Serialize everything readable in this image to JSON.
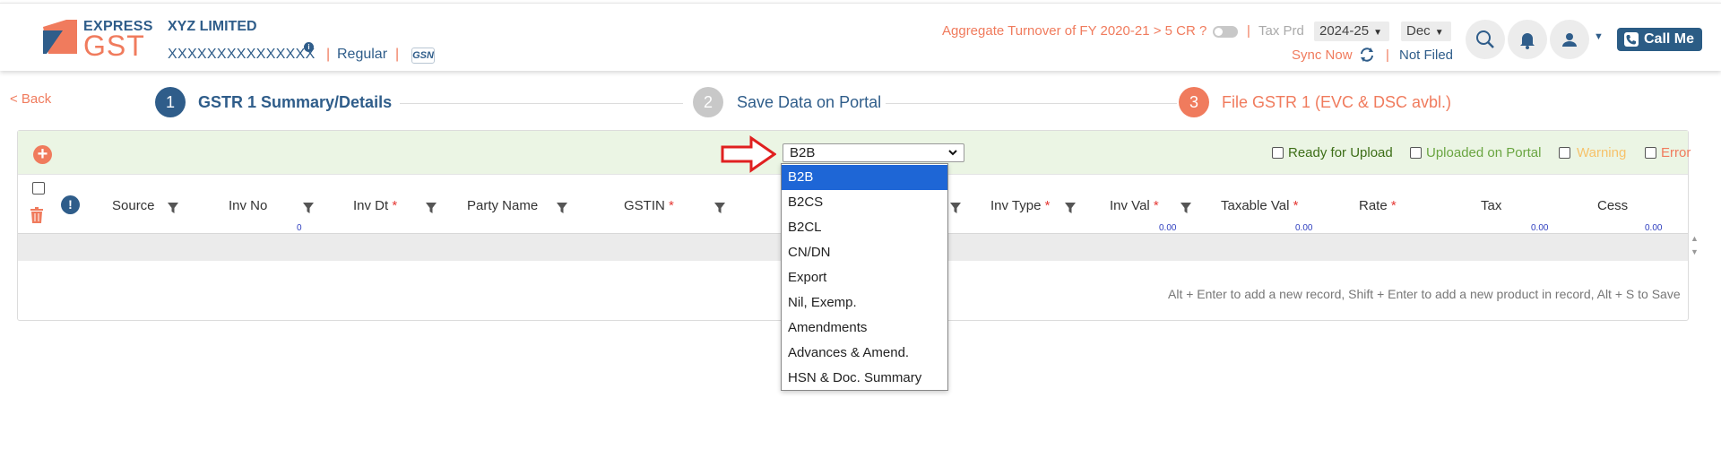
{
  "brand": {
    "line1": "EXPRESS",
    "line2": "GST",
    "colors": {
      "primary": "#2f5d8a",
      "accent": "#f07b5d"
    }
  },
  "company": {
    "name": "XYZ LIMITED",
    "gstin": "XXXXXXXXXXXXXXX",
    "info_badge": "i",
    "sep": "|",
    "reg_type": "Regular",
    "gsn_badge": "GSN"
  },
  "topbar": {
    "aggregate_question": "Aggregate Turnover of FY 2020-21 > 5 CR ?",
    "sep": "|",
    "tax_prd_label": "Tax Prd",
    "year": "2024-25",
    "month": "Dec",
    "sync_now": "Sync Now",
    "status": "Not Filed",
    "call_me": "Call Me",
    "icons": [
      "search-icon",
      "bell-icon",
      "user-icon",
      "phone-icon"
    ]
  },
  "nav": {
    "back": "< Back"
  },
  "steps": [
    {
      "num": "1",
      "label": "GSTR 1 Summary/Details",
      "state": "active"
    },
    {
      "num": "2",
      "label": "Save Data on Portal",
      "state": "pending"
    },
    {
      "num": "3",
      "label": "File GSTR 1 (EVC & DSC avbl.)",
      "state": "highlight"
    }
  ],
  "toolbar": {
    "selected_type": "B2B",
    "filters": [
      {
        "label": "Ready for Upload",
        "color": "#3d6e17"
      },
      {
        "label": "Uploaded on Portal",
        "color": "#6aa541"
      },
      {
        "label": "Warning",
        "color": "#f7c26a"
      },
      {
        "label": "Error",
        "color": "#f07b5d"
      }
    ]
  },
  "table": {
    "columns": [
      "Source",
      "Inv No",
      "Inv Dt",
      "Party Name",
      "GSTIN",
      "Inv Type",
      "Inv Val",
      "Taxable Val",
      "Rate",
      "Tax",
      "Cess"
    ],
    "required_mark": "*",
    "subtotals": {
      "inv_no": "0",
      "inv_val": "0.00",
      "taxable_val": "0.00",
      "tax": "0.00",
      "cess": "0.00"
    },
    "hint": "Alt + Enter to add a new record, Shift + Enter to add a new product in record, Alt + S to Save"
  },
  "dropdown": {
    "options": [
      "B2B",
      "B2CS",
      "B2CL",
      "CN/DN",
      "Export",
      "Nil, Exemp.",
      "Amendments",
      "Advances & Amend.",
      "HSN & Doc. Summary"
    ],
    "selected_index": 0,
    "highlight_color": "#1e66d6"
  }
}
